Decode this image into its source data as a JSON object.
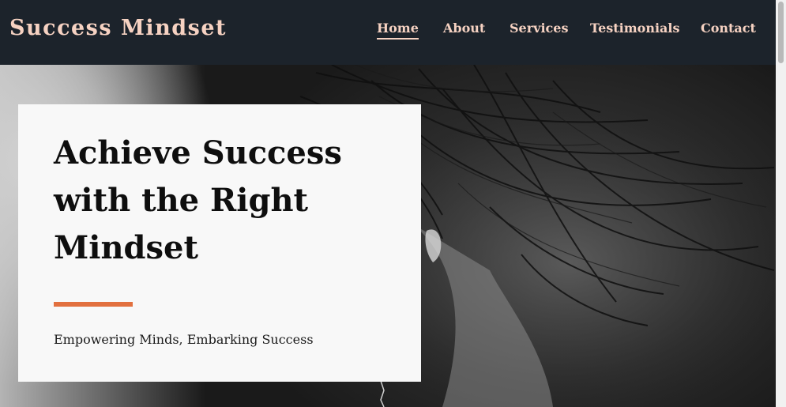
{
  "header": {
    "brand": "Success Mindset",
    "nav": [
      {
        "label": "Home",
        "active": true
      },
      {
        "label": "About",
        "active": false
      },
      {
        "label": "Services",
        "active": false
      },
      {
        "label": "Testimonials",
        "active": false
      },
      {
        "label": "Contact",
        "active": false
      }
    ]
  },
  "hero": {
    "headline": "Achieve Success with the Right Mindset",
    "tagline": "Empowering Minds, Embarking Success",
    "background_image": "black-and-white-portrait-woman-windswept-hair"
  },
  "colors": {
    "header_bg": "#1c232b",
    "brand_text": "#f6d2c2",
    "card_bg": "#f8f8f8",
    "accent": "#e2703f",
    "headline_text": "#0e0e0e"
  }
}
